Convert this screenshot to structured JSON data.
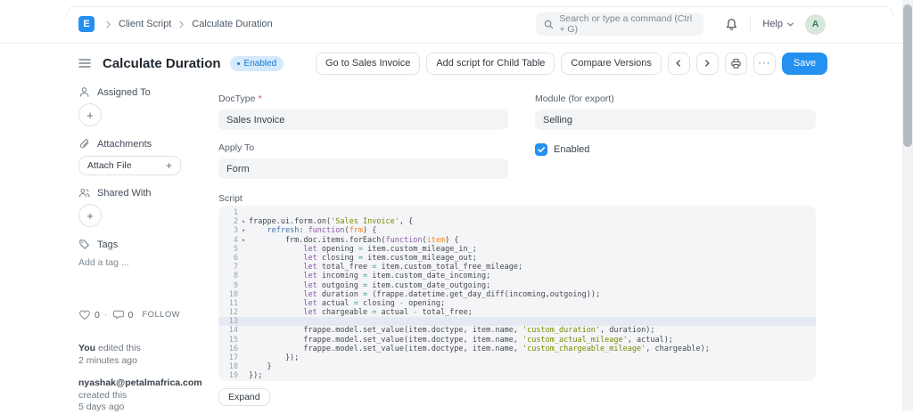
{
  "navbar": {
    "logo_letter": "E",
    "breadcrumb": [
      "Client Script",
      "Calculate Duration"
    ],
    "search_placeholder": "Search or type a command (Ctrl + G)",
    "help_label": "Help",
    "avatar_initial": "A"
  },
  "header": {
    "title": "Calculate Duration",
    "status_badge": "Enabled",
    "buttons": [
      "Go to Sales Invoice",
      "Add script for Child Table",
      "Compare Versions"
    ],
    "ellipsis": "···",
    "save_label": "Save"
  },
  "sidebar": {
    "assigned_to": "Assigned To",
    "attachments": "Attachments",
    "attach_file": "Attach File",
    "shared_with": "Shared With",
    "tags": "Tags",
    "add_tag_placeholder": "Add a tag ...",
    "plus": "+",
    "like_count": "0",
    "comment_count": "0",
    "dot_separator": "·",
    "follow": "FOLLOW",
    "edited_by": "You",
    "edited_action": "edited this",
    "edited_time": "2 minutes ago",
    "created_by": "nyashak@petalmafrica.com",
    "created_action": "created this",
    "created_time": "5 days ago"
  },
  "form": {
    "doctype_label": "DocType",
    "required_marker": "*",
    "doctype_value": "Sales Invoice",
    "module_label": "Module (for export)",
    "module_value": "Selling",
    "apply_to_label": "Apply To",
    "apply_to_value": "Form",
    "enabled_label": "Enabled",
    "script_label": "Script",
    "expand_label": "Expand"
  },
  "editor": {
    "fold_glyph": "▾",
    "lines": [
      {
        "n": 1,
        "seg": []
      },
      {
        "n": 2,
        "fold": true,
        "seg": [
          [
            "d",
            "frappe.ui.form.on("
          ],
          [
            "s",
            "'Sales Invoice'"
          ],
          [
            "d",
            ", {"
          ]
        ]
      },
      {
        "n": 3,
        "fold": true,
        "seg": [
          [
            "d",
            "    "
          ],
          [
            "f",
            "refresh"
          ],
          [
            "d",
            ": "
          ],
          [
            "k",
            "function"
          ],
          [
            "d",
            "("
          ],
          [
            "p",
            "frm"
          ],
          [
            "d",
            ") {"
          ]
        ]
      },
      {
        "n": 4,
        "fold": true,
        "seg": [
          [
            "d",
            "        frm.doc.items.forEach("
          ],
          [
            "k",
            "function"
          ],
          [
            "d",
            "("
          ],
          [
            "p",
            "item"
          ],
          [
            "d",
            ") {"
          ]
        ]
      },
      {
        "n": 5,
        "seg": [
          [
            "d",
            "            "
          ],
          [
            "k",
            "let"
          ],
          [
            "d",
            " opening "
          ],
          [
            "o",
            "="
          ],
          [
            "d",
            " item.custom_mileage_in_;"
          ]
        ]
      },
      {
        "n": 6,
        "seg": [
          [
            "d",
            "            "
          ],
          [
            "k",
            "let"
          ],
          [
            "d",
            " closing "
          ],
          [
            "o",
            "="
          ],
          [
            "d",
            " item.custom_mileage_out;"
          ]
        ]
      },
      {
        "n": 7,
        "seg": [
          [
            "d",
            "            "
          ],
          [
            "k",
            "let"
          ],
          [
            "d",
            " total_free "
          ],
          [
            "o",
            "="
          ],
          [
            "d",
            " item.custom_total_free_mileage;"
          ]
        ]
      },
      {
        "n": 8,
        "seg": [
          [
            "d",
            "            "
          ],
          [
            "k",
            "let"
          ],
          [
            "d",
            " incoming "
          ],
          [
            "o",
            "="
          ],
          [
            "d",
            " item.custom_date_incoming;"
          ]
        ]
      },
      {
        "n": 9,
        "seg": [
          [
            "d",
            "            "
          ],
          [
            "k",
            "let"
          ],
          [
            "d",
            " outgoing "
          ],
          [
            "o",
            "="
          ],
          [
            "d",
            " item.custom_date_outgoing;"
          ]
        ]
      },
      {
        "n": 10,
        "seg": [
          [
            "d",
            "            "
          ],
          [
            "k",
            "let"
          ],
          [
            "d",
            " duration "
          ],
          [
            "o",
            "="
          ],
          [
            "d",
            " (frappe.datetime.get_day_diff(incoming,outgoing));"
          ]
        ]
      },
      {
        "n": 11,
        "seg": [
          [
            "d",
            "            "
          ],
          [
            "k",
            "let"
          ],
          [
            "d",
            " actual "
          ],
          [
            "o",
            "="
          ],
          [
            "d",
            " closing "
          ],
          [
            "o",
            "-"
          ],
          [
            "d",
            " opening;"
          ]
        ]
      },
      {
        "n": 12,
        "seg": [
          [
            "d",
            "            "
          ],
          [
            "k",
            "let"
          ],
          [
            "d",
            " chargeable "
          ],
          [
            "o",
            "="
          ],
          [
            "d",
            " actual "
          ],
          [
            "o",
            "-"
          ],
          [
            "d",
            " total_free;"
          ]
        ]
      },
      {
        "n": 13,
        "active": true,
        "seg": []
      },
      {
        "n": 14,
        "seg": [
          [
            "d",
            "            frappe.model.set_value(item.doctype, item.name, "
          ],
          [
            "s",
            "'custom_duration'"
          ],
          [
            "d",
            ", duration);"
          ]
        ]
      },
      {
        "n": 15,
        "seg": [
          [
            "d",
            "            frappe.model.set_value(item.doctype, item.name, "
          ],
          [
            "s",
            "'custom_actual_mileage'"
          ],
          [
            "d",
            ", actual);"
          ]
        ]
      },
      {
        "n": 16,
        "seg": [
          [
            "d",
            "            frappe.model.set_value(item.doctype, item.name, "
          ],
          [
            "s",
            "'custom_chargeable_mileage'"
          ],
          [
            "d",
            ", chargeable);"
          ]
        ]
      },
      {
        "n": 17,
        "seg": [
          [
            "d",
            "        });"
          ]
        ]
      },
      {
        "n": 18,
        "seg": [
          [
            "d",
            "    }"
          ]
        ]
      },
      {
        "n": 19,
        "seg": [
          [
            "d",
            "});"
          ]
        ]
      }
    ]
  },
  "colors": {
    "accent": "#2490ef",
    "badge_bg": "#d6eafc",
    "badge_text": "#1777d3",
    "input_bg": "#f3f4f6",
    "editor_bg": "#f4f5f7",
    "active_line_bg": "#e4eaf1",
    "code_default": "#45494e",
    "code_string": "#718c00",
    "code_keyword": "#8959a8",
    "code_function": "#4271ae",
    "code_param": "#f5871f",
    "code_operator": "#3e999f"
  }
}
